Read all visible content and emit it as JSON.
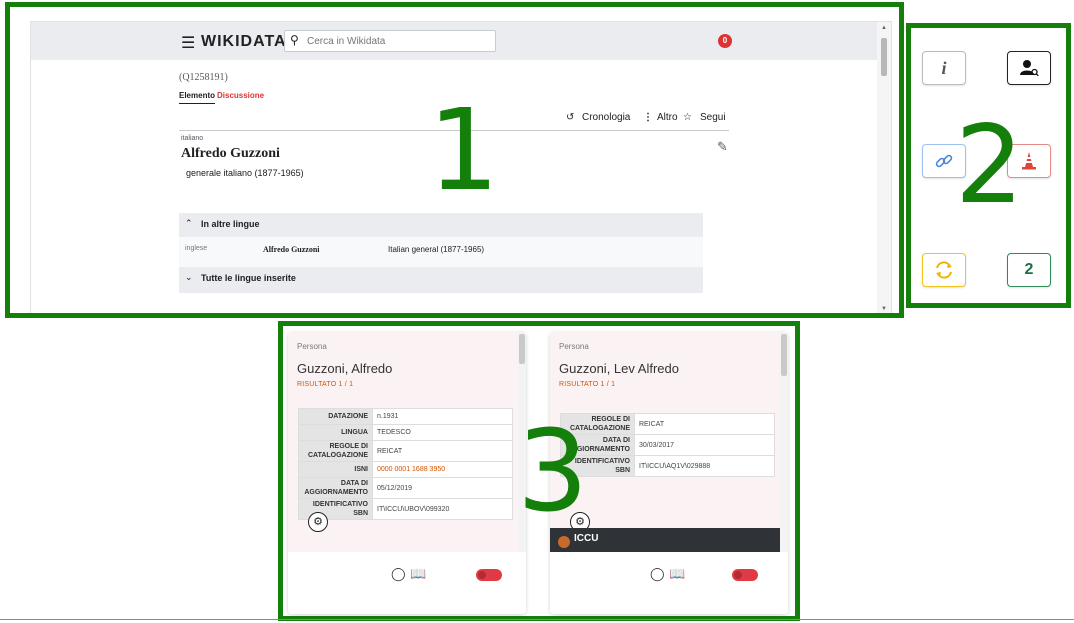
{
  "annotations": {
    "panel1": "1",
    "panel2": "2",
    "panel3": "3"
  },
  "wikidata": {
    "logo": "WIKIDATA",
    "search_placeholder": "Cerca in Wikidata",
    "notifications_count": "0",
    "item_id": "(Q1258191)",
    "tabs": {
      "item": "Elemento",
      "discussion": "Discussione"
    },
    "actions": {
      "history": "Cronologia",
      "more": "Altro",
      "follow": "Segui"
    },
    "language_small": "italiano",
    "label": "Alfredo Guzzoni",
    "description": "generale italiano (1877-1965)",
    "other_languages_title": "In altre lingue",
    "other_languages": [
      {
        "lang": "inglese",
        "label": "Alfredo Guzzoni",
        "description": "Italian general (1877-1965)"
      }
    ],
    "all_languages": "Tutte le lingue inserite"
  },
  "buttons": {
    "info_glyph": "i",
    "badge_number": "2",
    "icons": [
      "info-icon",
      "person-search-icon",
      "link-icon",
      "traffic-cone-icon",
      "sync-icon",
      "count-badge"
    ],
    "colors": {
      "link_border": "#9cc1f0",
      "cone_border": "#e88a8a",
      "sync_border": "#f0c419",
      "count_border": "#2e8b57"
    }
  },
  "cards": [
    {
      "kind": "Persona",
      "name": "Guzzoni, Alfredo",
      "result": "RISULTATO 1 / 1",
      "rows": [
        {
          "key": "DATAZIONE",
          "value": "n.1931"
        },
        {
          "key": "LINGUA",
          "value": "TEDESCO"
        },
        {
          "key": "REGOLE DI CATALOGAZIONE",
          "value": "REICAT"
        },
        {
          "key": "ISNI",
          "value": "0000 0001 1688 3950"
        },
        {
          "key": "DATA DI AGGIORNAMENTO",
          "value": "05/12/2019"
        },
        {
          "key": "IDENTIFICATIVO SBN",
          "value": "IT\\ICCU\\UBOV\\099320"
        }
      ]
    },
    {
      "kind": "Persona",
      "name": "Guzzoni, Lev Alfredo",
      "result": "RISULTATO 1 / 1",
      "rows": [
        {
          "key": "REGOLE DI CATALOGAZIONE",
          "value": "REICAT"
        },
        {
          "key": "DATA DI AGGIORNAMENTO",
          "value": "30/03/2017"
        },
        {
          "key": "IDENTIFICATIVO SBN",
          "value": "IT\\ICCU\\AQ1V\\029888"
        }
      ],
      "footer_brand": "ICCU"
    }
  ]
}
